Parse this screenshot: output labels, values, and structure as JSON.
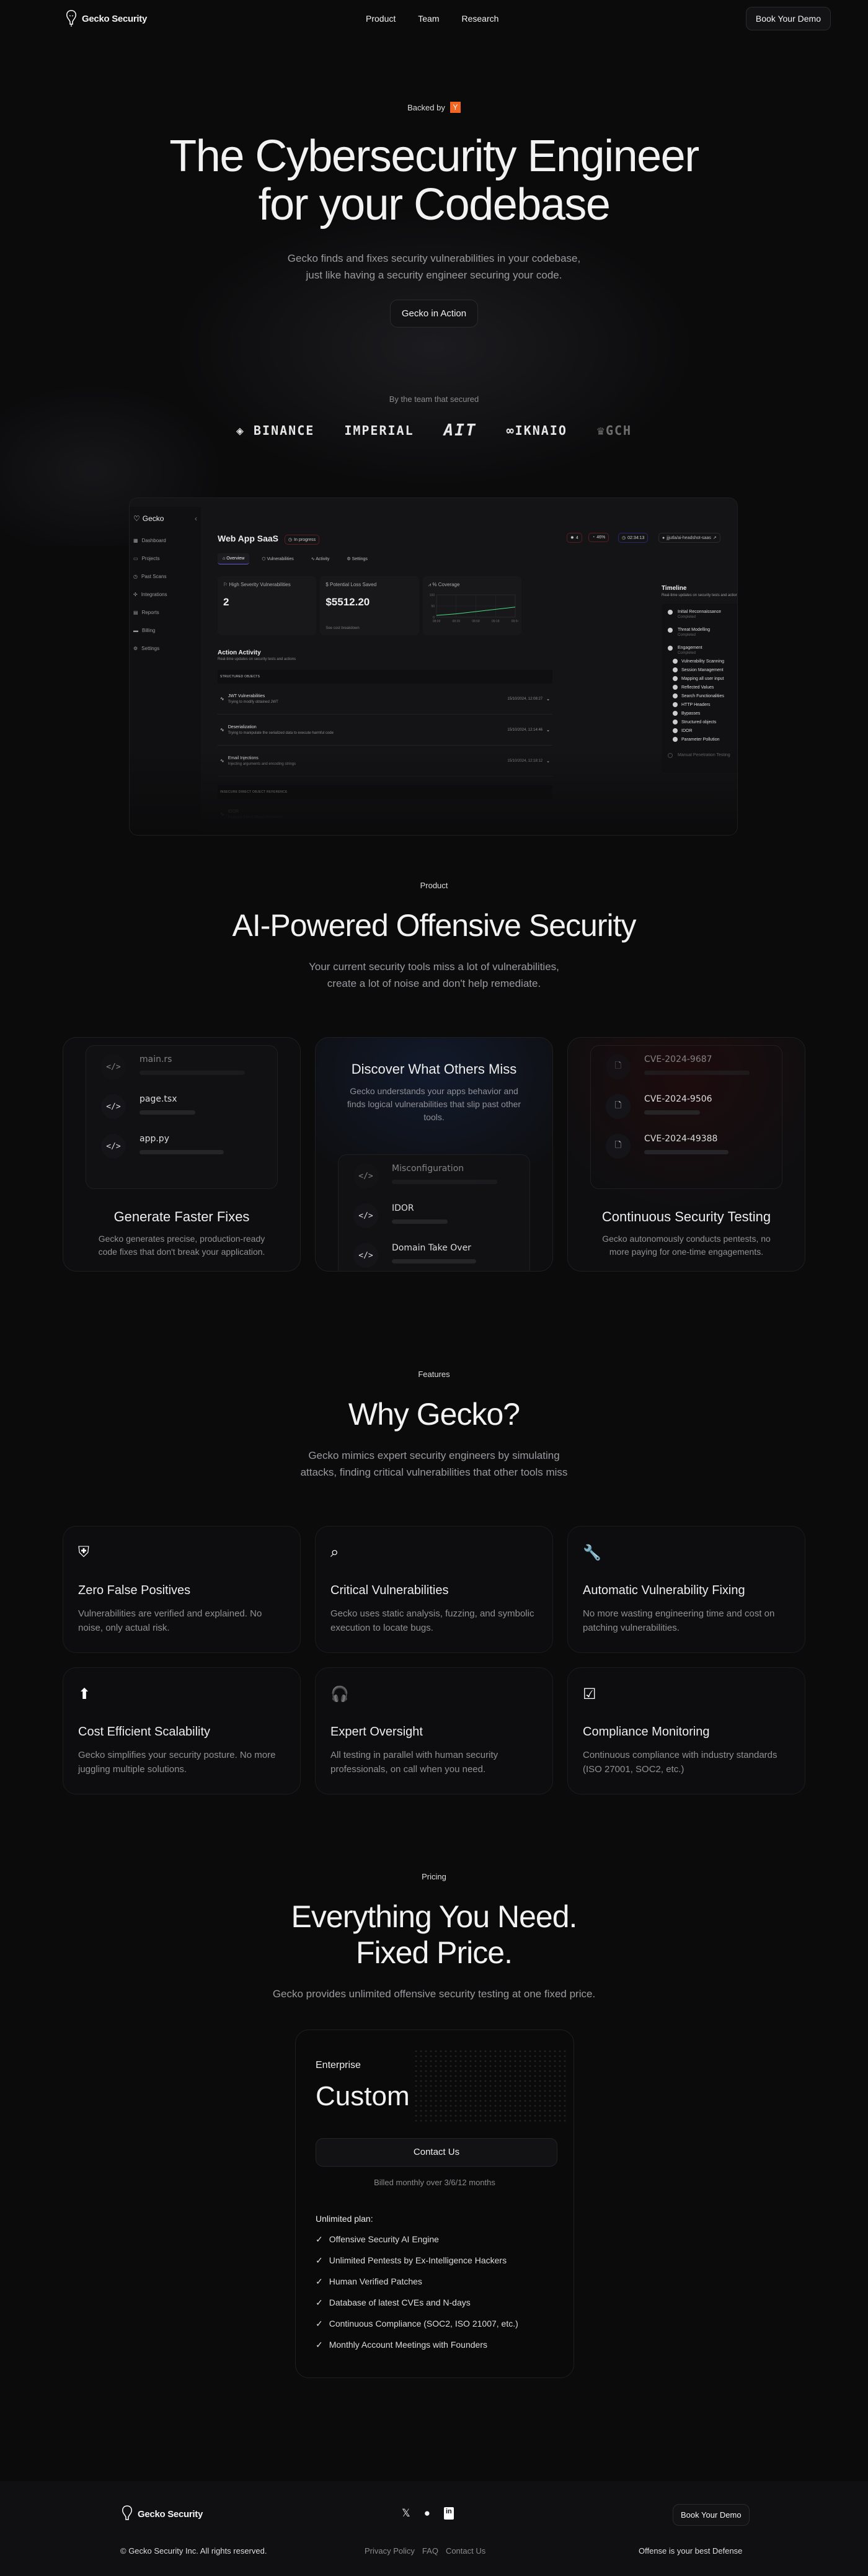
{
  "nav": {
    "brand": "Gecko Security",
    "links": [
      "Product",
      "Team",
      "Research"
    ],
    "cta": "Book Your Demo"
  },
  "hero": {
    "backed_by": "Backed by",
    "backer_badge": "Y",
    "title_line1": "The Cybersecurity Engineer",
    "title_line2": "for your Codebase",
    "subtitle_line1": "Gecko finds and fixes security vulnerabilities in your codebase,",
    "subtitle_line2": "just like having a security engineer securing your code.",
    "cta": "Gecko in Action",
    "trusted_label": "By the team that secured",
    "logos": [
      "BINANCE",
      "IMPERIAL",
      "AIT",
      "IKNAIO",
      "GCH"
    ]
  },
  "app": {
    "brand": "Gecko",
    "sidebar": [
      "Dashboard",
      "Projects",
      "Past Scans",
      "Integrations",
      "Reports",
      "Billing",
      "Settings"
    ],
    "project": "Web App SaaS",
    "status": "In progress",
    "badges": {
      "bugs": "4",
      "progress": "46%",
      "timer": "02:34:13",
      "repo": "jjjutla/ai-headshot-saas"
    },
    "tabs": [
      "Overview",
      "Vulnerabilities",
      "Activity",
      "Settings"
    ],
    "cards": [
      {
        "label": "High Severity Vulnerabilities",
        "value": "2"
      },
      {
        "label": "Potential Loss Saved",
        "value": "$5512.20",
        "link": "See cost breakdown"
      },
      {
        "label": "% Coverage"
      }
    ],
    "coverage_chart": {
      "type": "line",
      "x": [
        "08:09",
        "08:39",
        "08:58",
        "09:18",
        "09:54"
      ],
      "values": [
        8,
        15,
        25,
        35,
        45
      ],
      "ylim": [
        0,
        100
      ],
      "yticks": [
        "100",
        "50",
        "0"
      ]
    },
    "activity": {
      "title": "Action Activity",
      "desc": "Real-time updates on security tests and actions",
      "groups": [
        {
          "name": "STRUCTURED OBJECTS",
          "rows": [
            {
              "title": "JWT Vulnerabilities",
              "desc": "Trying to modify obtained JWT",
              "time": "15/10/2024, 12:08:27"
            },
            {
              "title": "Deserialization",
              "desc": "Trying to manipulate the serialized data to execute harmful code",
              "time": "15/10/2024, 12:14:46"
            },
            {
              "title": "Email Injections",
              "desc": "Injecting arguments and encoding strings",
              "time": "15/10/2024, 12:18:12"
            }
          ]
        },
        {
          "name": "INSECURE DIRECT OBJECT REFERENCE",
          "rows": [
            {
              "title": "IDOR",
              "desc": "Insecure Direct Object Reference",
              "time": ""
            }
          ]
        }
      ]
    },
    "timeline": {
      "title": "Timeline",
      "desc": "Real-time updates on security tests and actions",
      "stages": [
        {
          "name": "Initial Reconnaissance",
          "status": "Completed"
        },
        {
          "name": "Threat Modelling",
          "status": "Completed"
        },
        {
          "name": "Engagement",
          "status": "Completed"
        }
      ],
      "subitems": [
        "Vulnerability Scanning",
        "Session Management",
        "Mapping all user input",
        "Reflected Values",
        "Search Functionalities",
        "HTTP Headers",
        "Bypasses",
        "Structured objects",
        "IDOR",
        "Parameter Pollution"
      ],
      "pending": "Manual Penetration Testing"
    }
  },
  "product": {
    "pill": "Product",
    "title": "AI-Powered Offensive Security",
    "sub_line1": "Your current security tools miss a lot of vulnerabilities,",
    "sub_line2": "create a lot of noise and don't help remediate.",
    "cards": [
      {
        "title": "Generate Faster Fixes",
        "desc": "Gecko generates precise, production-ready code fixes that don't break your application.",
        "items": [
          "main.rs",
          "page.tsx",
          "app.py"
        ]
      },
      {
        "title": "Discover What Others Miss",
        "desc": "Gecko understands your apps behavior and finds logical vulnerabilities that slip past other tools.",
        "items": [
          "Misconfiguration",
          "IDOR",
          "Domain Take Over"
        ]
      },
      {
        "title": "Continuous Security Testing",
        "desc": "Gecko autonomously conducts pentests, no more paying for one-time engagements.",
        "items": [
          "CVE-2024-9687",
          "CVE-2024-9506",
          "CVE-2024-49388"
        ]
      }
    ]
  },
  "features": {
    "pill": "Features",
    "title": "Why Gecko?",
    "sub_line1": "Gecko mimics expert security engineers by simulating",
    "sub_line2": "attacks, finding critical vulnerabilities that other tools miss",
    "items": [
      {
        "icon": "shield-check",
        "title": "Zero False Positives",
        "desc": "Vulnerabilities are verified and explained. No noise, only actual risk."
      },
      {
        "icon": "search",
        "title": "Critical Vulnerabilities",
        "desc": "Gecko uses static analysis, fuzzing, and symbolic execution to locate bugs."
      },
      {
        "icon": "wrench",
        "title": "Automatic Vulnerability Fixing",
        "desc": "No more wasting engineering time and cost on patching vulnerabilities."
      },
      {
        "icon": "cloud-upload",
        "title": "Cost Efficient Scalability",
        "desc": "Gecko simplifies your security posture. No more juggling multiple solutions."
      },
      {
        "icon": "headset",
        "title": "Expert Oversight",
        "desc": "All testing in parallel with human security professionals, on call when you need."
      },
      {
        "icon": "double-check",
        "title": "Compliance Monitoring",
        "desc": "Continuous compliance with industry standards (ISO 27001, SOC2, etc.)"
      }
    ]
  },
  "pricing": {
    "pill": "Pricing",
    "title_line1": "Everything You Need.",
    "title_line2": "Fixed Price.",
    "sub": "Gecko provides unlimited offensive security testing at one fixed price.",
    "tier": "Enterprise",
    "price": "Custom",
    "cta": "Contact Us",
    "billing": "Billed monthly over 3/6/12 months",
    "plan_label": "Unlimited plan:",
    "plan_items": [
      "Offensive Security AI  Engine",
      "Unlimited Pentests by Ex-Intelligence Hackers",
      "Human Verified Patches",
      "Database of latest CVEs and N-days",
      "Continuous Compliance (SOC2, ISO 21007, etc.)",
      "Monthly Account Meetings with Founders"
    ]
  },
  "footer": {
    "brand": "Gecko Security",
    "cta": "Book Your Demo",
    "copyright": "© Gecko Security Inc. All rights reserved.",
    "links": [
      "Privacy Policy",
      "FAQ",
      "Contact Us"
    ],
    "tagline": "Offense is your best Defense"
  }
}
